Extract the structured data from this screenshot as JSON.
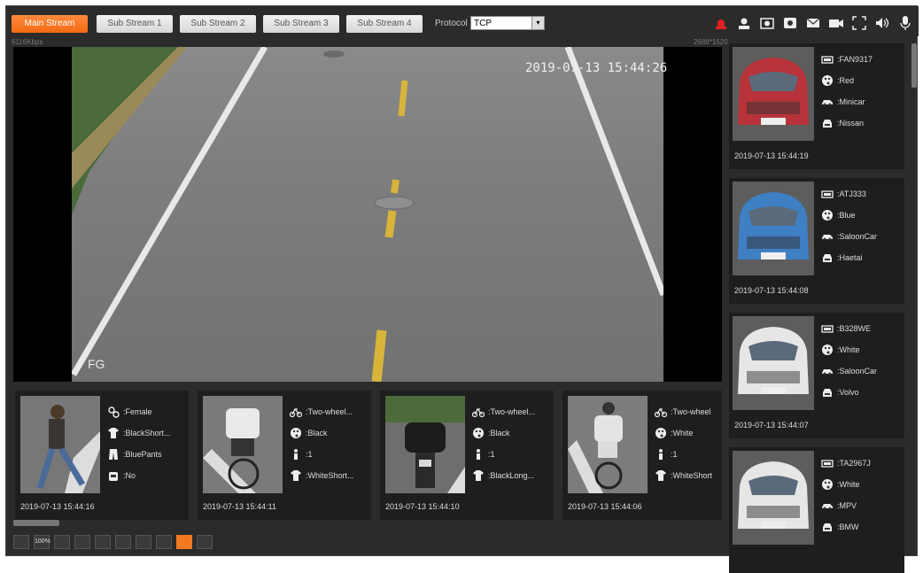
{
  "streams": {
    "tabs": [
      {
        "label": "Main Stream",
        "active": true
      },
      {
        "label": "Sub Stream 1",
        "active": false
      },
      {
        "label": "Sub Stream 2",
        "active": false
      },
      {
        "label": "Sub Stream 3",
        "active": false
      },
      {
        "label": "Sub Stream 4",
        "active": false
      }
    ],
    "protocol_label": "Protocol",
    "protocol_value": "TCP"
  },
  "toolbar_icons": [
    "alarm-icon",
    "user-icon",
    "snapshot-icon",
    "record-icon",
    "message-icon",
    "video-icon",
    "fullscreen-icon",
    "audio-icon",
    "microphone-icon"
  ],
  "video": {
    "bitrate": "6116Kbps",
    "resolution": "2688*1520",
    "timestamp": "2019-07-13 15:44:26",
    "channel_tag": "FG"
  },
  "detections": [
    {
      "attrs": [
        ":Female",
        ":BlackShort...",
        ":BluePants",
        ":No"
      ],
      "icons": [
        "gender-icon",
        "top-clothing-icon",
        "pants-icon",
        "bag-icon"
      ],
      "timestamp": "2019-07-13 15:44:16"
    },
    {
      "attrs": [
        ":Two-wheel...",
        ":Black",
        ":1",
        ":WhiteShort..."
      ],
      "icons": [
        "bicycle-icon",
        "color-palette-icon",
        "person-icon",
        "top-clothing-icon"
      ],
      "timestamp": "2019-07-13 15:44:11"
    },
    {
      "attrs": [
        ":Two-wheel...",
        ":Black",
        ":1",
        ":BlackLong..."
      ],
      "icons": [
        "bicycle-icon",
        "color-palette-icon",
        "person-icon",
        "top-clothing-icon"
      ],
      "timestamp": "2019-07-13 15:44:10"
    },
    {
      "attrs": [
        ":Two-wheel",
        ":White",
        ":1",
        ":WhiteShort"
      ],
      "icons": [
        "bicycle-icon",
        "color-palette-icon",
        "person-icon",
        "top-clothing-icon"
      ],
      "timestamp": "2019-07-13 15:44:06"
    }
  ],
  "vehicles": [
    {
      "attrs": [
        ":FAN9317",
        ":Red",
        ":Minicar",
        ":Nissan"
      ],
      "timestamp": "2019-07-13 15:44:19",
      "color": "#b8323a"
    },
    {
      "attrs": [
        ":ATJ333",
        ":Blue",
        ":SaloonCar",
        ":Haetai"
      ],
      "timestamp": "2019-07-13 15:44:08",
      "color": "#3f7fc4"
    },
    {
      "attrs": [
        ":B328WE",
        ":White",
        ":SaloonCar",
        ":Volvo"
      ],
      "timestamp": "2019-07-13 15:44:07",
      "color": "#e6e6e6"
    },
    {
      "attrs": [
        ":TA2967J",
        ":White",
        ":MPV",
        ":BMW"
      ],
      "timestamp": "",
      "color": "#e6e6e6"
    }
  ],
  "vehicle_icons": [
    "plate-icon",
    "color-palette-icon",
    "car-type-icon",
    "car-brand-icon"
  ],
  "bottom_icons": [
    {
      "name": "scene-icon",
      "label": "",
      "active": false
    },
    {
      "name": "zoom-100-icon",
      "label": "100%",
      "active": false
    },
    {
      "name": "fit-icon",
      "label": "",
      "active": false
    },
    {
      "name": "ratio-icon",
      "label": "",
      "active": false
    },
    {
      "name": "window-icon",
      "label": "",
      "active": false
    },
    {
      "name": "adjust-icon",
      "label": "",
      "active": false
    },
    {
      "name": "zoom-icon",
      "label": "",
      "active": false
    },
    {
      "name": "focus-icon",
      "label": "",
      "active": false
    },
    {
      "name": "rules-icon",
      "label": "",
      "active": true
    },
    {
      "name": "display-icon",
      "label": "",
      "active": false
    }
  ]
}
